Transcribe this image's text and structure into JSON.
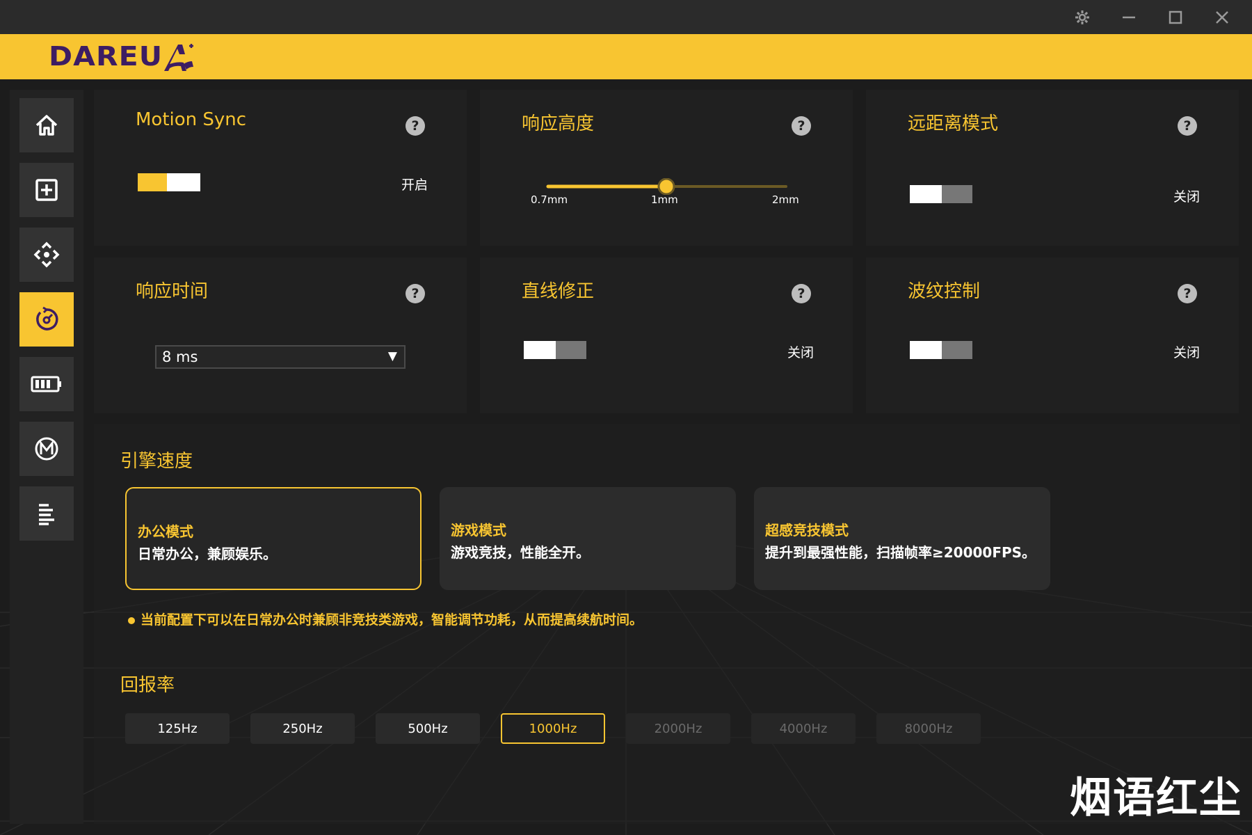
{
  "brand": {
    "logo_text": "DAREU",
    "accent": "#f8c531",
    "logo_color": "#3d1d63"
  },
  "window_controls": [
    "gear-icon",
    "minimize-icon",
    "maximize-icon",
    "close-icon"
  ],
  "sidebar": {
    "items": [
      {
        "icon": "home-icon",
        "active": false
      },
      {
        "icon": "add-box-icon",
        "active": false
      },
      {
        "icon": "dpad-icon",
        "active": false
      },
      {
        "icon": "performance-icon",
        "active": true
      },
      {
        "icon": "battery-icon",
        "active": false
      },
      {
        "icon": "macro-icon",
        "active": false
      },
      {
        "icon": "text-lines-icon",
        "active": false
      }
    ]
  },
  "cards": {
    "motion_sync": {
      "title": "Motion Sync",
      "state": "开启",
      "on": true
    },
    "lift_off": {
      "title": "响应高度",
      "ticks": [
        "0.7mm",
        "1mm",
        "2mm"
      ],
      "value": "1mm"
    },
    "long_distance": {
      "title": "远距离模式",
      "state": "关闭",
      "on": false
    },
    "response_time": {
      "title": "响应时间",
      "selected": "8 ms"
    },
    "angle_snap": {
      "title": "直线修正",
      "state": "关闭",
      "on": false
    },
    "ripple": {
      "title": "波纹控制",
      "state": "关闭",
      "on": false
    }
  },
  "engine": {
    "title": "引擎速度",
    "modes": [
      {
        "name": "办公模式",
        "desc": "日常办公，兼顾娱乐。",
        "active": true
      },
      {
        "name": "游戏模式",
        "desc": "游戏竞技，性能全开。",
        "active": false
      },
      {
        "name": "超感竞技模式",
        "desc": "提升到最强性能，扫描帧率≥20000FPS。",
        "active": false
      }
    ],
    "note": "当前配置下可以在日常办公时兼顾非竞技类游戏，智能调节功耗，从而提高续航时间。"
  },
  "polling": {
    "title": "回报率",
    "rates": [
      {
        "label": "125Hz",
        "state": "normal"
      },
      {
        "label": "250Hz",
        "state": "normal"
      },
      {
        "label": "500Hz",
        "state": "normal"
      },
      {
        "label": "1000Hz",
        "state": "active"
      },
      {
        "label": "2000Hz",
        "state": "disabled"
      },
      {
        "label": "4000Hz",
        "state": "disabled"
      },
      {
        "label": "8000Hz",
        "state": "disabled"
      }
    ]
  },
  "watermark": "烟语红尘"
}
